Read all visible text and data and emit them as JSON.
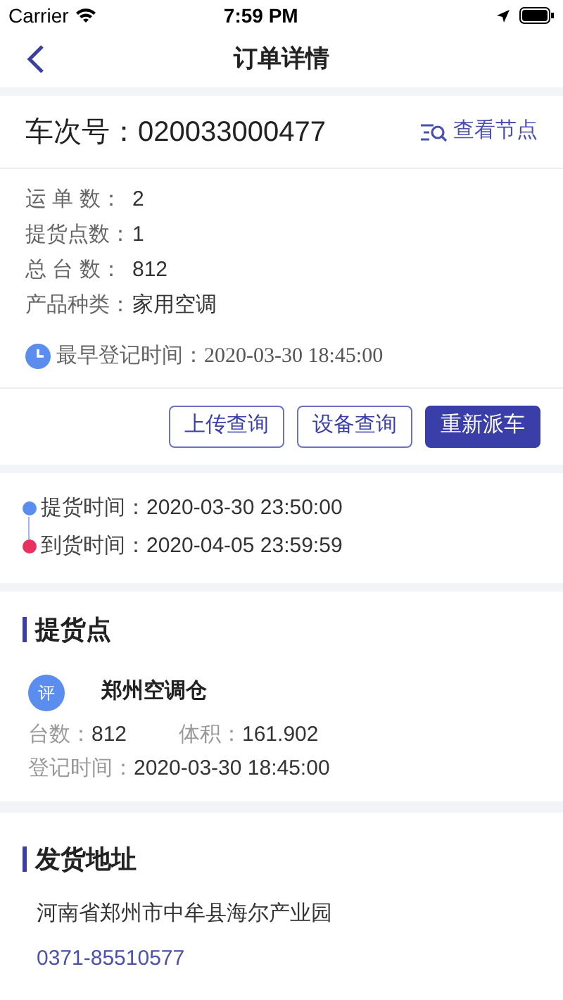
{
  "status_bar": {
    "carrier": "Carrier",
    "time": "7:59 PM"
  },
  "nav": {
    "title": "订单详情"
  },
  "trip": {
    "label": "车次号：",
    "number": "020033000477",
    "action": "查看节点"
  },
  "info": [
    {
      "label": "运 单 数：",
      "value": "2"
    },
    {
      "label": "提货点数：",
      "value": "1"
    },
    {
      "label": "总 台 数：",
      "value": "812"
    },
    {
      "label": "产品种类：",
      "value": "家用空调"
    }
  ],
  "earliest": {
    "label": "最早登记时间：",
    "value": "2020-03-30 18:45:00"
  },
  "buttons": [
    {
      "label": "上传查询",
      "primary": false
    },
    {
      "label": "设备查询",
      "primary": false
    },
    {
      "label": "重新派车",
      "primary": true
    }
  ],
  "timeline": [
    {
      "label": "提货时间：",
      "value": "2020-03-30 23:50:00",
      "color": "#5b8def"
    },
    {
      "label": "到货时间：",
      "value": "2020-04-05 23:59:59",
      "color": "#e8315f"
    }
  ],
  "pickup": {
    "heading": "提货点",
    "badge": "评",
    "name": "郑州空调仓",
    "qty_label": "台数：",
    "qty": "812",
    "vol_label": "体积：",
    "vol": "161.902",
    "time_label": "登记时间：",
    "time": "2020-03-30 18:45:00"
  },
  "address": {
    "heading": "发货地址",
    "text": "河南省郑州市中牟县海尔产业园",
    "phone": "0371-85510577"
  }
}
